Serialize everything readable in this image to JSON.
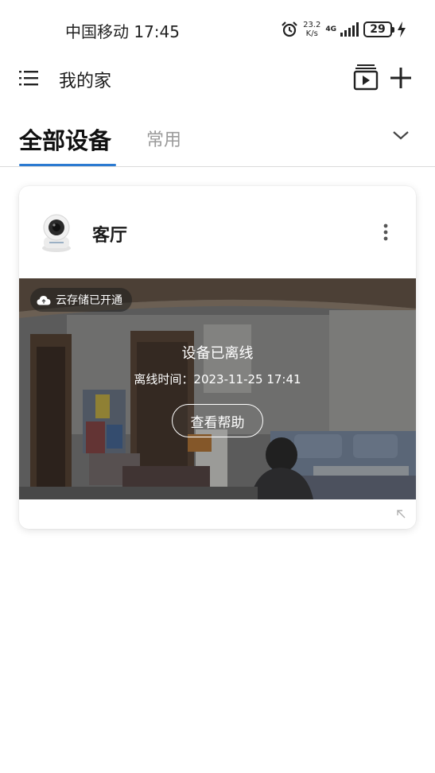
{
  "status_bar": {
    "carrier_time": "中国移动 17:45",
    "net_speed_value": "23.2",
    "net_speed_unit": "K/s",
    "network_type": "4G",
    "battery": "29",
    "icons": [
      "alarm-icon",
      "signal-icon",
      "battery-icon",
      "charging-icon"
    ]
  },
  "header": {
    "title": "我的家",
    "icons": [
      "menu-icon",
      "media-icon",
      "add-icon"
    ]
  },
  "tabs": {
    "all": "全部设备",
    "common": "常用"
  },
  "device_card": {
    "room": "客厅",
    "cloud_badge": "云存储已开通",
    "offline_title": "设备已离线",
    "offline_time": "离线时间：2023-11-25 17:41",
    "help_button": "查看帮助"
  },
  "colors": {
    "accent": "#2b7ad1",
    "tab_inactive": "#9a9a9a"
  }
}
